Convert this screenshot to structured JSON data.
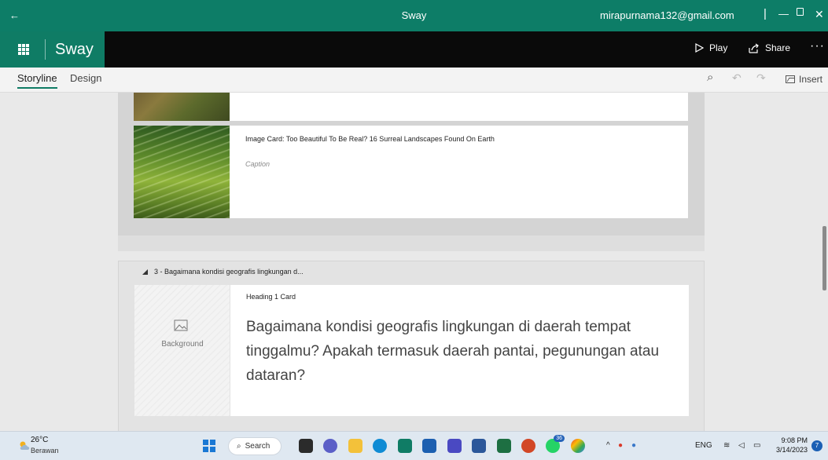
{
  "window": {
    "back_glyph": "←",
    "title": "Sway",
    "user_email": "mirapurnama132@gmail.com",
    "separator": "|",
    "minimize_glyph": "—",
    "close_glyph": "✕"
  },
  "appbar": {
    "app_name": "Sway",
    "play_label": "Play",
    "share_label": "Share",
    "more_glyph": "···"
  },
  "toolbar": {
    "tabs": [
      {
        "label": "Storyline",
        "active": true
      },
      {
        "label": "Design",
        "active": false
      }
    ],
    "search_glyph": "⌕",
    "undo_glyph": "↶",
    "redo_glyph": "↷",
    "insert_label": "Insert"
  },
  "canvas": {
    "image_card": {
      "title": "Image Card: Too Beautiful To Be Real? 16 Surreal Landscapes Found On Earth",
      "caption": "Caption"
    },
    "section3": {
      "header": "3 - Bagaimana kondisi geografis lingkungan d...",
      "card_type": "Heading 1 Card",
      "background_label": "Background",
      "heading_text": "Bagaimana kondisi geografis lingkungan di daerah tempat tinggalmu? Apakah termasuk daerah pantai, pegunungan atau dataran?"
    }
  },
  "taskbar": {
    "weather_temp": "26°C",
    "weather_desc": "Berawan",
    "search_label": "Search",
    "whatsapp_badge": "36",
    "tray_lang": "ENG",
    "tray_chevron": "^",
    "time": "9:08 PM",
    "date": "3/14/2023",
    "notification_count": "7"
  },
  "colors": {
    "title_bar": "#0d7d67",
    "app_bar": "#0a0a0a",
    "accent": "#0f7c65",
    "taskbar": "#dfe8f1"
  }
}
